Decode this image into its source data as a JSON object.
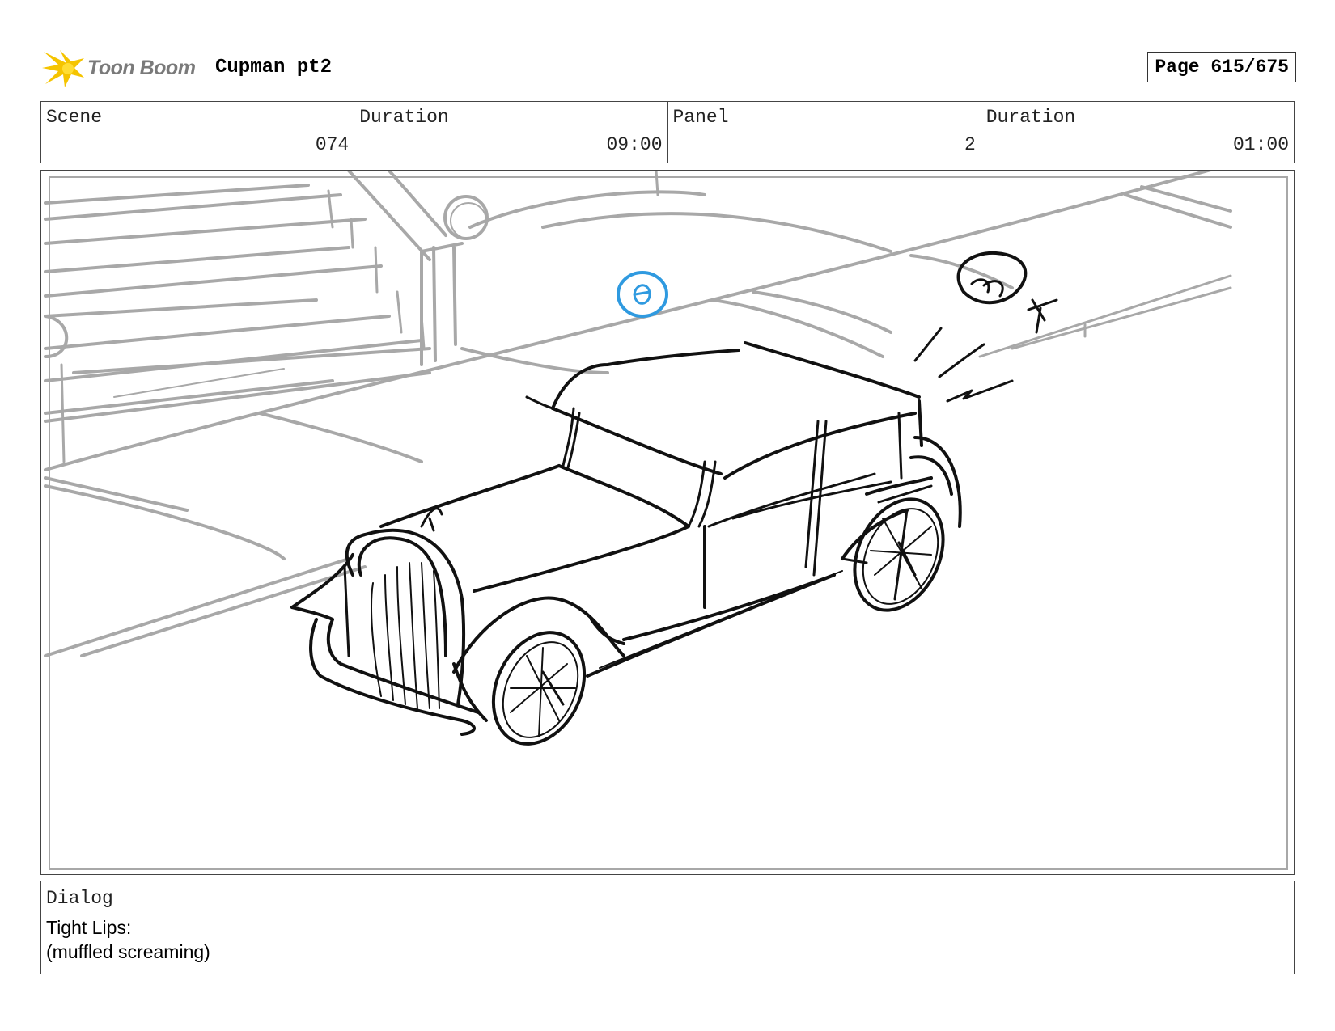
{
  "header": {
    "logo_text": "Toon Boom",
    "project_title": "Cupman pt2",
    "page_label": "Page 615/675"
  },
  "info": {
    "scene_label": "Scene",
    "scene_value": "074",
    "scene_duration_label": "Duration",
    "scene_duration_value": "09:00",
    "panel_label": "Panel",
    "panel_value": "2",
    "panel_duration_label": "Duration",
    "panel_duration_value": "01:00"
  },
  "dialog": {
    "label": "Dialog",
    "lines": [
      "Tight Lips:",
      "(muffled screaming)"
    ]
  },
  "colors": {
    "sketch_black": "#111111",
    "sketch_grey": "#a8a8a8",
    "annotation_blue": "#2f9ae0",
    "logo_yellow": "#f5c400"
  },
  "icons": {
    "logo": "toon-boom-star-icon",
    "annotation": "circled-number-marker"
  }
}
